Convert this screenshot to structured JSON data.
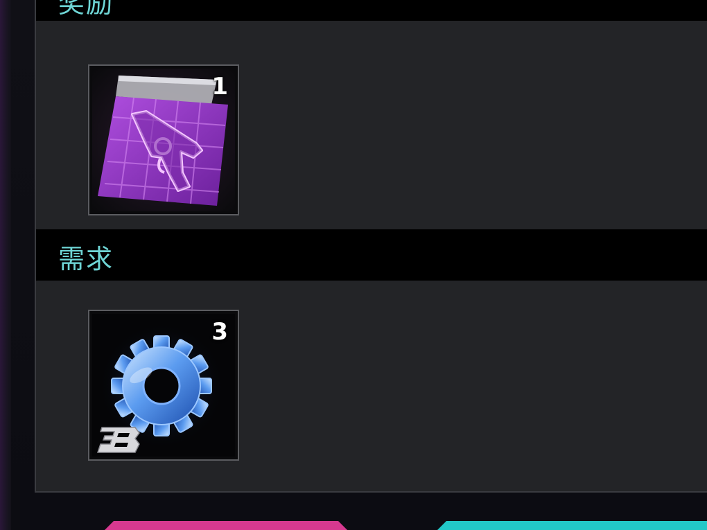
{
  "reward_section": {
    "title": "奖励",
    "item": {
      "icon": "revolver-blueprint-icon",
      "count": "1"
    }
  },
  "requirement_section": {
    "title": "需求",
    "item": {
      "icon": "gear-part-icon",
      "count": "3",
      "tier_badge": "tier-b-badge-icon"
    }
  },
  "colors": {
    "header_text": "#6fd6d6",
    "panel_bg": "#232427",
    "header_bg": "#000000",
    "blueprint_purple": "#9b3fc9",
    "gear_blue": "#4a8ee8",
    "button_pink": "#d6398f",
    "button_cyan": "#22c8c8"
  },
  "bottom_buttons": [
    {
      "name": "pink-action-button",
      "color": "#d6398f"
    },
    {
      "name": "cyan-action-button",
      "color": "#22c8c8"
    }
  ]
}
